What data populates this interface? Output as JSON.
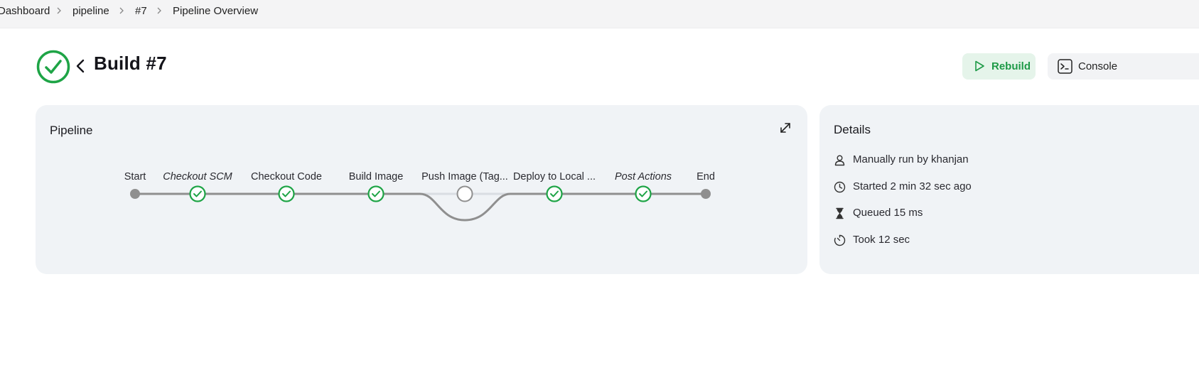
{
  "breadcrumb": {
    "items": [
      "Dashboard",
      "pipeline",
      "#7",
      "Pipeline Overview"
    ]
  },
  "header": {
    "title": "Build #7",
    "status": "success",
    "status_color": "#1ea446"
  },
  "actions": {
    "rebuild_label": "Rebuild",
    "console_label": "Console"
  },
  "pipeline": {
    "title": "Pipeline",
    "stages": [
      {
        "label": "Start",
        "italic": false,
        "state": "terminal"
      },
      {
        "label": "Checkout SCM",
        "italic": true,
        "state": "success"
      },
      {
        "label": "Checkout Code",
        "italic": false,
        "state": "success"
      },
      {
        "label": "Build Image",
        "italic": false,
        "state": "success"
      },
      {
        "label": "Push Image (Tag...",
        "italic": false,
        "state": "skipped"
      },
      {
        "label": "Deploy to Local ...",
        "italic": false,
        "state": "success"
      },
      {
        "label": "Post Actions",
        "italic": true,
        "state": "success"
      },
      {
        "label": "End",
        "italic": false,
        "state": "terminal"
      }
    ]
  },
  "details": {
    "title": "Details",
    "items": [
      {
        "icon": "user-icon",
        "text": "Manually run by khanjan"
      },
      {
        "icon": "clock-icon",
        "text": "Started 2 min 32 sec ago"
      },
      {
        "icon": "hourglass-icon",
        "text": "Queued 15 ms"
      },
      {
        "icon": "timer-icon",
        "text": "Took 12 sec"
      }
    ]
  }
}
